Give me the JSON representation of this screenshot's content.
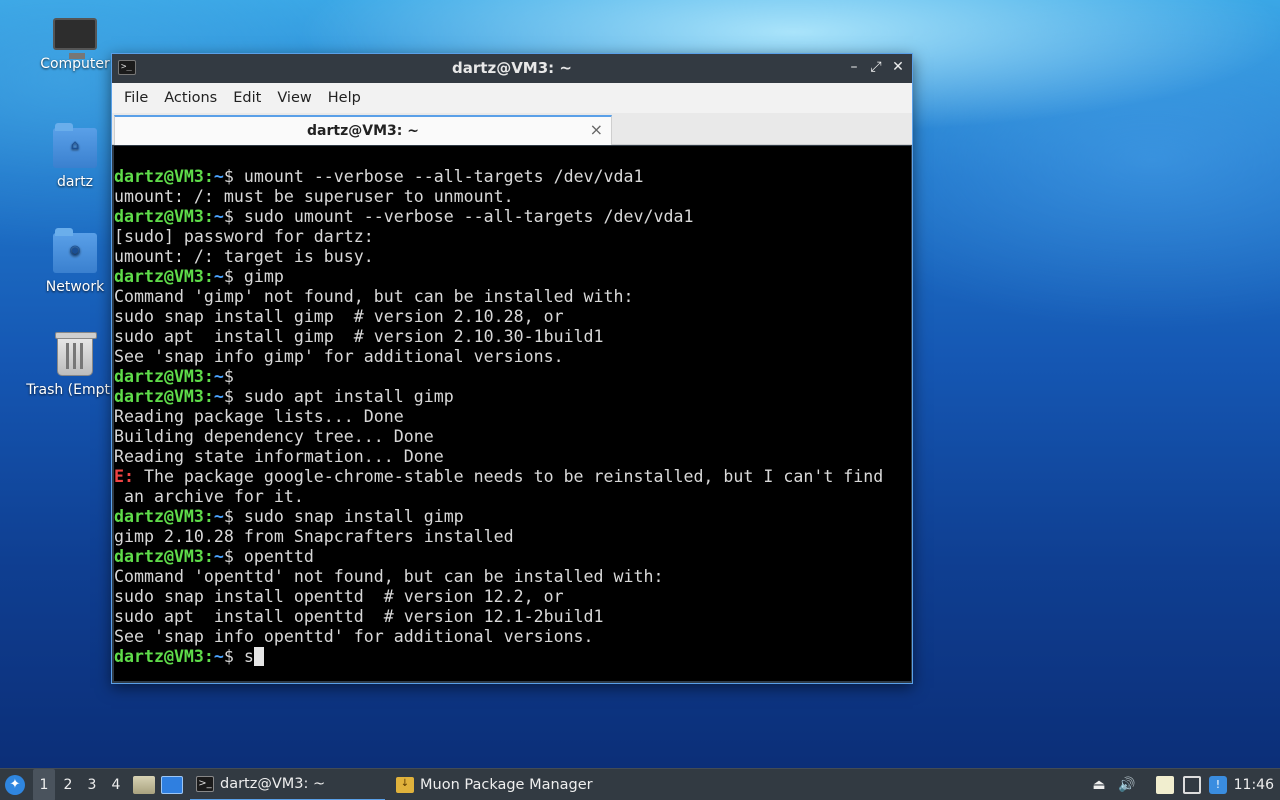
{
  "desktop": {
    "icons": [
      {
        "label": "Computer"
      },
      {
        "label": "dartz"
      },
      {
        "label": "Network"
      },
      {
        "label": "Trash (Empty)"
      }
    ]
  },
  "window": {
    "title": "dartz@VM3: ~",
    "controls": {
      "minimize": "–",
      "maximize": "⤢",
      "close": "✕"
    },
    "menu": {
      "file": "File",
      "actions": "Actions",
      "edit": "Edit",
      "view": "View",
      "help": "Help"
    },
    "tab": {
      "label": "dartz@VM3: ~",
      "close": "×"
    }
  },
  "terminal": {
    "prompt_user": "dartz@VM3:",
    "prompt_path": "~",
    "lines": [
      {
        "cmd": "$ umount --verbose --all-targets /dev/vda1"
      },
      {
        "out": "umount: /: must be superuser to unmount."
      },
      {
        "cmd": "$ sudo umount --verbose --all-targets /dev/vda1"
      },
      {
        "out": "[sudo] password for dartz:"
      },
      {
        "out": "umount: /: target is busy."
      },
      {
        "cmd": "$ gimp"
      },
      {
        "out": "Command 'gimp' not found, but can be installed with:"
      },
      {
        "out": "sudo snap install gimp  # version 2.10.28, or"
      },
      {
        "out": "sudo apt  install gimp  # version 2.10.30-1build1"
      },
      {
        "out": "See 'snap info gimp' for additional versions."
      },
      {
        "cmd": "$"
      },
      {
        "cmd": "$ sudo apt install gimp"
      },
      {
        "out": "Reading package lists... Done"
      },
      {
        "out": "Building dependency tree... Done"
      },
      {
        "out": "Reading state information... Done"
      },
      {
        "err": "E:",
        "out": " The package google-chrome-stable needs to be reinstalled, but I can't find"
      },
      {
        "out": " an archive for it."
      },
      {
        "cmd": "$ sudo snap install gimp"
      },
      {
        "out": "gimp 2.10.28 from Snapcrafters installed"
      },
      {
        "cmd": "$ openttd"
      },
      {
        "out": "Command 'openttd' not found, but can be installed with:"
      },
      {
        "out": "sudo snap install openttd  # version 12.2, or"
      },
      {
        "out": "sudo apt  install openttd  # version 12.1-2build1"
      },
      {
        "out": "See 'snap info openttd' for additional versions."
      },
      {
        "cmd": "$ s",
        "cursor": true
      }
    ]
  },
  "taskbar": {
    "workspaces": [
      "1",
      "2",
      "3",
      "4"
    ],
    "tasks": [
      {
        "label": "dartz@VM3: ~"
      },
      {
        "label": "Muon Package Manager"
      }
    ],
    "clock": "11:46"
  }
}
